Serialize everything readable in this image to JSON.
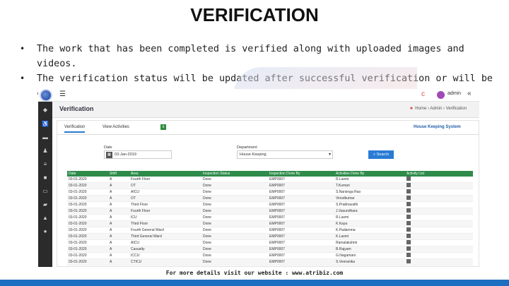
{
  "slide": {
    "title": "VERIFICATION",
    "bullets": [
      "The work that has been completed is verified along with uploaded images and videos.",
      "The verification status will be updated after successful verification or will be changed to ‘Redo’, if the work has to be redone."
    ],
    "footer": "For more details visit our website : www.atribiz.com"
  },
  "app": {
    "topbar": {
      "menu_icon": "☰",
      "user": "admin",
      "collapse": "«"
    },
    "page_title": "Verification",
    "breadcrumbs": [
      "Home",
      "Admin",
      "Verification"
    ],
    "tabs": [
      "Verification",
      "View Activities"
    ],
    "brand": "House Keeping System",
    "filters": {
      "date_label": "Date",
      "date_value": "03-Jan-2019",
      "department_label": "Department",
      "department_value": "House Keeping",
      "search_label": "Search"
    },
    "table": {
      "headers": [
        "Date",
        "Shift",
        "Area",
        "Inspection Status",
        "Inspection Done By",
        "Activities Done By",
        "Activity List"
      ],
      "rows": [
        [
          "03-01-2020",
          "A",
          "Fourth Floor",
          "Done",
          "EMP0007",
          "R.Laxmi",
          ""
        ],
        [
          "03-01-2020",
          "A",
          "OT",
          "Done",
          "EMP0007",
          "T.Kumari",
          ""
        ],
        [
          "03-01-2020",
          "A",
          "AICU",
          "Done",
          "EMP0007",
          "S.Narsinga Rao",
          ""
        ],
        [
          "03-01-2020",
          "A",
          "OT",
          "Done",
          "EMP0007",
          "Vinodkumar",
          ""
        ],
        [
          "03-01-2020",
          "A",
          "Third Floor",
          "Done",
          "EMP0007",
          "S.Prabhavathi",
          ""
        ],
        [
          "03-01-2020",
          "A",
          "Fourth Floor",
          "Done",
          "EMP0007",
          "J.Vasundhara",
          ""
        ],
        [
          "03-01-2020",
          "A",
          "ICU",
          "Done",
          "EMP0007",
          "R.Laxmi",
          ""
        ],
        [
          "03-01-2020",
          "A",
          "Third Floor",
          "Done",
          "EMP0007",
          "K.Kaya",
          ""
        ],
        [
          "03-01-2020",
          "A",
          "Fourth General Ward",
          "Done",
          "EMP0007",
          "K.Padamma",
          ""
        ],
        [
          "03-01-2020",
          "A",
          "Third General Ward",
          "Done",
          "EMP0007",
          "K.Laxmi",
          ""
        ],
        [
          "03-01-2020",
          "A",
          "AICU",
          "Done",
          "EMP0007",
          "Ramalakshmi",
          ""
        ],
        [
          "03-01-2020",
          "A",
          "Casualty",
          "Done",
          "EMP0007",
          "B.Rajyam",
          ""
        ],
        [
          "03-01-2020",
          "A",
          "ICCU",
          "Done",
          "EMP0007",
          "G.Nagamani",
          ""
        ],
        [
          "03-01-2020",
          "A",
          "CTICU",
          "Done",
          "EMP0007",
          "S.Veeranika",
          ""
        ]
      ]
    }
  }
}
